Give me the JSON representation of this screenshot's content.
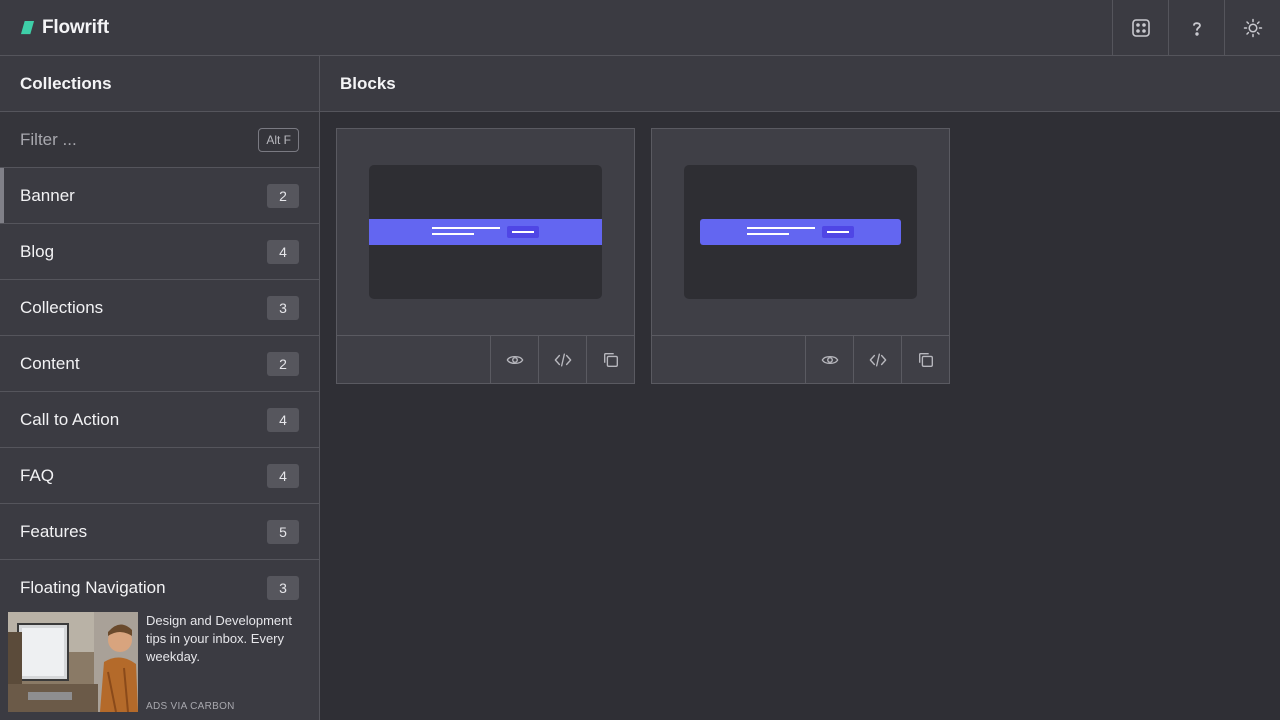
{
  "app": {
    "name": "Flowrift",
    "accent": "#3ecfa8"
  },
  "topbar": {
    "actions": [
      {
        "name": "random-dice-icon"
      },
      {
        "name": "help-icon"
      },
      {
        "name": "theme-sun-icon"
      }
    ]
  },
  "sidebar": {
    "title": "Collections",
    "filter": {
      "placeholder": "Filter ...",
      "shortcut": "Alt F"
    },
    "items": [
      {
        "label": "Banner",
        "count": "2",
        "active": true
      },
      {
        "label": "Blog",
        "count": "4"
      },
      {
        "label": "Collections",
        "count": "3"
      },
      {
        "label": "Content",
        "count": "2"
      },
      {
        "label": "Call to Action",
        "count": "4"
      },
      {
        "label": "FAQ",
        "count": "4"
      },
      {
        "label": "Features",
        "count": "5"
      },
      {
        "label": "Floating Navigation",
        "count": "3"
      }
    ]
  },
  "ad": {
    "text": "Design and Development tips in your inbox. Every weekday.",
    "credit": "ADS VIA CARBON"
  },
  "main": {
    "title": "Blocks",
    "cards": [
      {
        "variant": "full-width-banner",
        "banner_color": "#6366f1"
      },
      {
        "variant": "inset-banner",
        "banner_color": "#6366f1"
      }
    ],
    "card_actions": [
      "preview-eye-icon",
      "code-icon",
      "copy-icon"
    ]
  }
}
